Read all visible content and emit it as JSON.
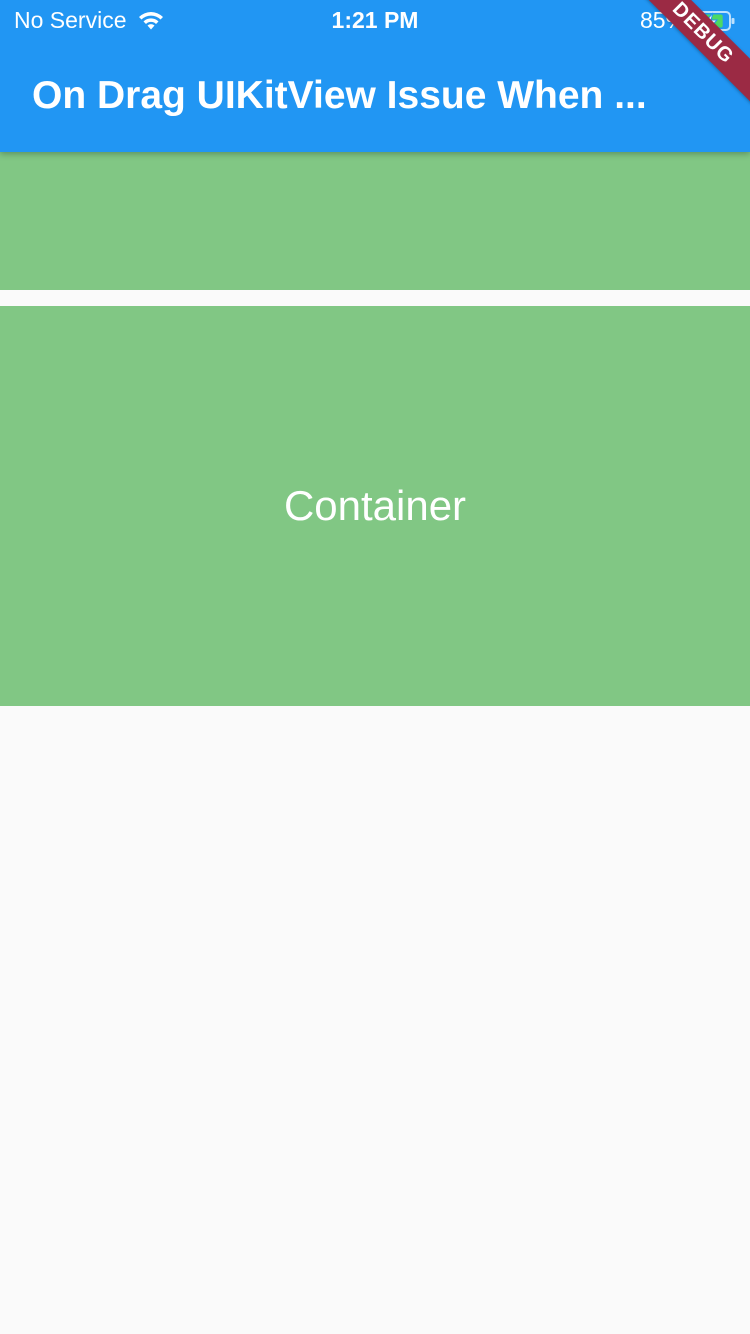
{
  "status_bar": {
    "carrier": "No Service",
    "time": "1:21 PM",
    "battery_percent": "85%",
    "battery_level": 0.85,
    "icons": [
      "wifi-icon",
      "battery-charging-icon"
    ]
  },
  "app_bar": {
    "title": "On Drag UIKitView Issue When ...",
    "color": "#2196f3"
  },
  "debug_banner": {
    "label": "DEBUG",
    "color": "#9b2a44"
  },
  "content": {
    "block_color": "#81c784",
    "container_label": "Container"
  }
}
